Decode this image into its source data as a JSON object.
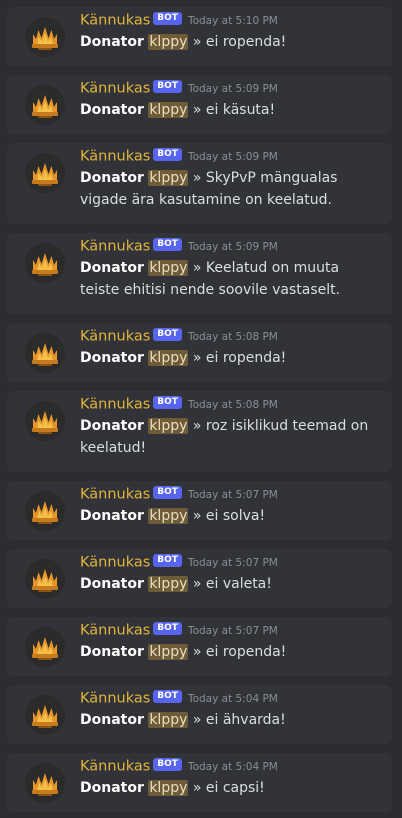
{
  "messages": [
    {
      "author": "Kännukas",
      "badge": "BOT",
      "time": "Today at 5:10 PM",
      "rank": "Donator",
      "mention": "klppy",
      "separator": "»",
      "text": "ei ropenda!"
    },
    {
      "author": "Kännukas",
      "badge": "BOT",
      "time": "Today at 5:09 PM",
      "rank": "Donator",
      "mention": "klppy",
      "separator": "»",
      "text": "ei käsuta!"
    },
    {
      "author": "Kännukas",
      "badge": "BOT",
      "time": "Today at 5:09 PM",
      "rank": "Donator",
      "mention": "klppy",
      "separator": "»",
      "text": "SkyPvP mängualas vigade ära kasutamine on keelatud."
    },
    {
      "author": "Kännukas",
      "badge": "BOT",
      "time": "Today at 5:09 PM",
      "rank": "Donator",
      "mention": "klppy",
      "separator": "»",
      "text": "Keelatud on muuta teiste ehitisi nende soovile vastaselt."
    },
    {
      "author": "Kännukas",
      "badge": "BOT",
      "time": "Today at 5:08 PM",
      "rank": "Donator",
      "mention": "klppy",
      "separator": "»",
      "text": "ei ropenda!"
    },
    {
      "author": "Kännukas",
      "badge": "BOT",
      "time": "Today at 5:08 PM",
      "rank": "Donator",
      "mention": "klppy",
      "separator": "»",
      "text": "roz isiklikud teemad on keelatud!"
    },
    {
      "author": "Kännukas",
      "badge": "BOT",
      "time": "Today at 5:07 PM",
      "rank": "Donator",
      "mention": "klppy",
      "separator": "»",
      "text": "ei solva!"
    },
    {
      "author": "Kännukas",
      "badge": "BOT",
      "time": "Today at 5:07 PM",
      "rank": "Donator",
      "mention": "klppy",
      "separator": "»",
      "text": "ei valeta!"
    },
    {
      "author": "Kännukas",
      "badge": "BOT",
      "time": "Today at 5:07 PM",
      "rank": "Donator",
      "mention": "klppy",
      "separator": "»",
      "text": "ei ropenda!"
    },
    {
      "author": "Kännukas",
      "badge": "BOT",
      "time": "Today at 5:04 PM",
      "rank": "Donator",
      "mention": "klppy",
      "separator": "»",
      "text": "ei ähvarda!"
    },
    {
      "author": "Kännukas",
      "badge": "BOT",
      "time": "Today at 5:04 PM",
      "rank": "Donator",
      "mention": "klppy",
      "separator": "»",
      "text": "ei capsi!"
    }
  ],
  "avatar_icon": "crown-logo-icon",
  "colors": {
    "author": "#e1b43c",
    "bot_badge": "#5865f2",
    "mention_bg": "#6d5c35",
    "card_bg": "#313338",
    "page_bg": "#2b2d31"
  }
}
